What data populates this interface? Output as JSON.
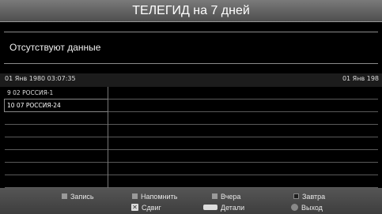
{
  "header": {
    "title": "ТЕЛЕГИД на 7 дней"
  },
  "info": {
    "message": "Отсутствуют данные"
  },
  "timeline": {
    "start": "01 Янв 1980 03:07:35",
    "end": "01 Янв 198"
  },
  "channels": [
    {
      "label": "9 02 РОССИЯ-1"
    },
    {
      "label": "10 07 РОССИЯ-24"
    }
  ],
  "footer": {
    "record": "Запись",
    "remind": "Напомнить",
    "yesterday": "Вчера",
    "tomorrow": "Завтра",
    "shift": "Сдвиг",
    "details": "Детали",
    "exit": "Выход"
  },
  "icons": {
    "record": "dark-square-icon",
    "remind": "dark-square-icon",
    "yesterday": "dark-square-icon",
    "tomorrow": "dark-square-icon",
    "shift": "plus-icon",
    "details": "info-key-icon",
    "exit": "exit-circle-icon"
  },
  "colors": {
    "background": "#000000",
    "header": "#6a6a6a",
    "footer": "#4a4a4a"
  }
}
